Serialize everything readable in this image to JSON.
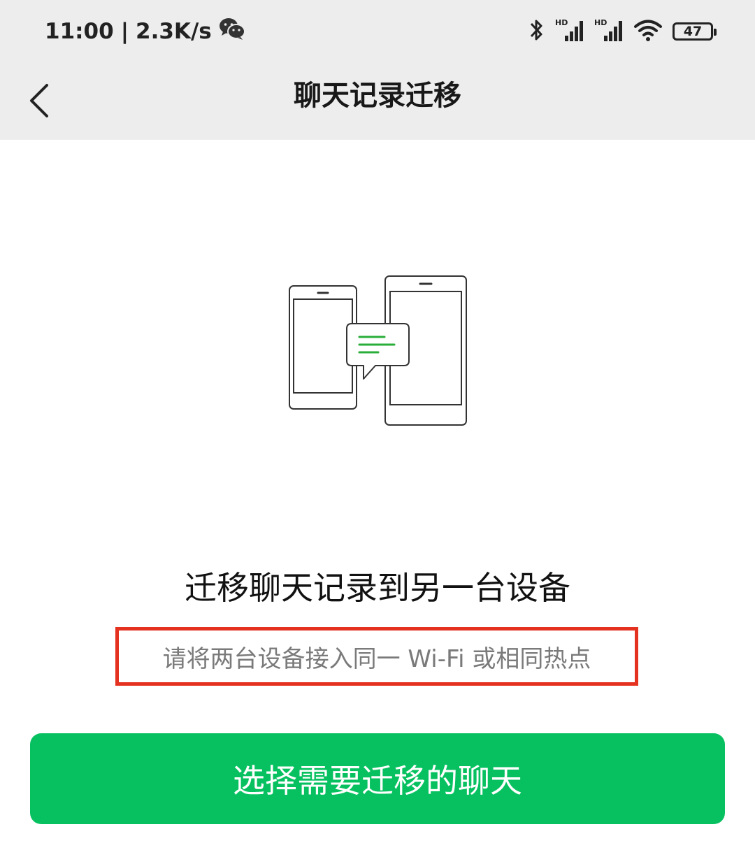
{
  "status_bar": {
    "time": "11:00",
    "separator": "|",
    "net_speed": "2.3K/s",
    "battery_level": "47",
    "icons": [
      "wechat-icon",
      "bluetooth-icon",
      "hd-signal-icon",
      "hd-signal-icon",
      "wifi-icon",
      "battery-icon"
    ]
  },
  "nav": {
    "title": "聊天记录迁移",
    "back_icon": "chevron-left-icon"
  },
  "main": {
    "illustration": "two-phones-chat-transfer-icon",
    "headline": "迁移聊天记录到另一台设备",
    "hint": "请将两台设备接入同一 Wi-Fi 或相同热点",
    "hint_highlight_color": "#e5311f",
    "primary_button_label": "选择需要迁移的聊天"
  },
  "colors": {
    "brand_green": "#07c160",
    "bar_background": "#ededed",
    "illustration_accent": "#2aae3a"
  }
}
